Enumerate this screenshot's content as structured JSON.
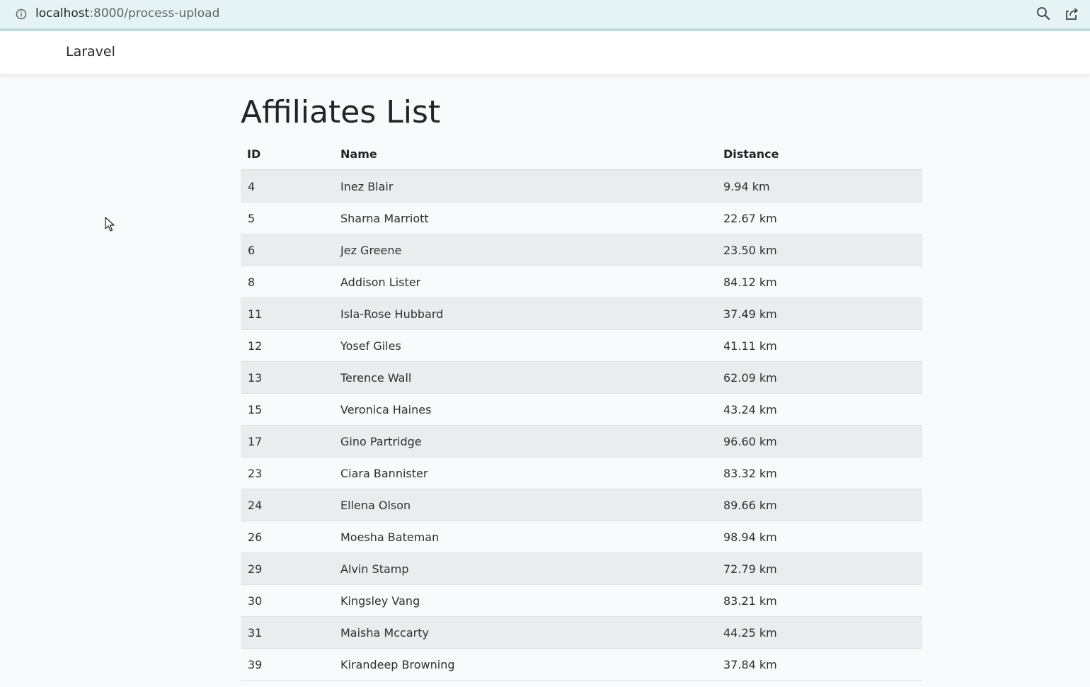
{
  "browser": {
    "url_host": "localhost",
    "url_path": ":8000/process-upload"
  },
  "navbar": {
    "brand": "Laravel"
  },
  "main": {
    "title": "Affiliates List",
    "table": {
      "headers": [
        "ID",
        "Name",
        "Distance"
      ],
      "rows": [
        {
          "id": "4",
          "name": "Inez Blair",
          "distance": "9.94 km"
        },
        {
          "id": "5",
          "name": "Sharna Marriott",
          "distance": "22.67 km"
        },
        {
          "id": "6",
          "name": "Jez Greene",
          "distance": "23.50 km"
        },
        {
          "id": "8",
          "name": "Addison Lister",
          "distance": "84.12 km"
        },
        {
          "id": "11",
          "name": "Isla-Rose Hubbard",
          "distance": "37.49 km"
        },
        {
          "id": "12",
          "name": "Yosef Giles",
          "distance": "41.11 km"
        },
        {
          "id": "13",
          "name": "Terence Wall",
          "distance": "62.09 km"
        },
        {
          "id": "15",
          "name": "Veronica Haines",
          "distance": "43.24 km"
        },
        {
          "id": "17",
          "name": "Gino Partridge",
          "distance": "96.60 km"
        },
        {
          "id": "23",
          "name": "Ciara Bannister",
          "distance": "83.32 km"
        },
        {
          "id": "24",
          "name": "Ellena Olson",
          "distance": "89.66 km"
        },
        {
          "id": "26",
          "name": "Moesha Bateman",
          "distance": "98.94 km"
        },
        {
          "id": "29",
          "name": "Alvin Stamp",
          "distance": "72.79 km"
        },
        {
          "id": "30",
          "name": "Kingsley Vang",
          "distance": "83.21 km"
        },
        {
          "id": "31",
          "name": "Maisha Mccarty",
          "distance": "44.25 km"
        },
        {
          "id": "39",
          "name": "Kirandeep Browning",
          "distance": "37.84 km"
        }
      ]
    }
  },
  "icons": {
    "info": "info-icon",
    "zoom": "zoom-icon",
    "share": "share-icon",
    "cursor": "mouse-cursor-icon"
  },
  "colors": {
    "address_bar": "#e5f3f4",
    "page_background": "#f8fafc",
    "striped_row": "#ebecee"
  }
}
